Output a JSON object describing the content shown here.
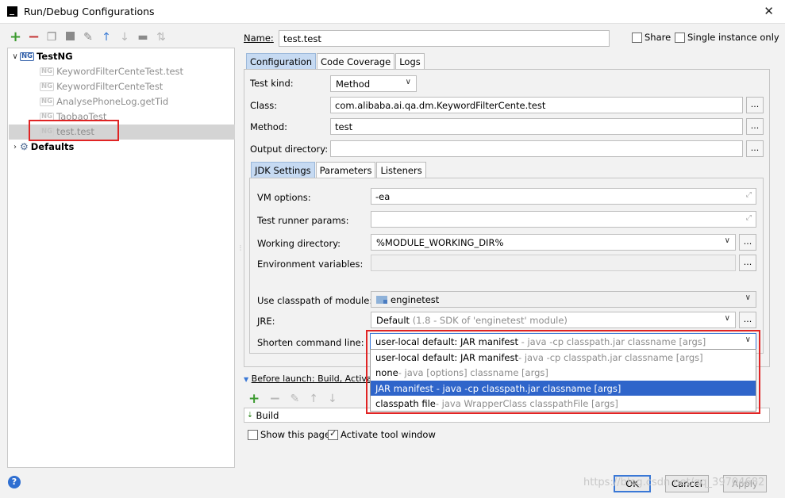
{
  "window": {
    "title": "Run/Debug Configurations",
    "close_glyph": "✕"
  },
  "toolbar": {
    "icons": [
      "add-icon",
      "remove-icon",
      "copy-icon",
      "save-icon",
      "wrench-icon",
      "move-up-icon",
      "move-down-icon",
      "folder-icon",
      "sort-icon"
    ]
  },
  "tree": {
    "root": {
      "label": "TestNG",
      "icon": "NG"
    },
    "children": [
      {
        "label": "KeywordFilterCenteTest.test"
      },
      {
        "label": "KeywordFilterCenteTest"
      },
      {
        "label": "AnalysePhoneLog.getTid"
      },
      {
        "label": "TaobaoTest"
      },
      {
        "label": "test.test",
        "selected": true
      }
    ],
    "defaults": {
      "label": "Defaults"
    }
  },
  "form": {
    "name_label": "Name:",
    "name_value": "test.test",
    "share_label": "Share",
    "single_instance_label": "Single instance only",
    "tabs": [
      "Configuration",
      "Code Coverage",
      "Logs"
    ],
    "test_kind_label": "Test kind:",
    "test_kind_value": "Method",
    "class_label": "Class:",
    "class_value": "com.alibaba.ai.qa.dm.KeywordFilterCente.test",
    "method_label": "Method:",
    "method_value": "test",
    "output_dir_label": "Output directory:",
    "output_dir_value": "",
    "dots": "..."
  },
  "inner": {
    "tabs": [
      "JDK Settings",
      "Parameters",
      "Listeners"
    ],
    "vm_options_label": "VM options:",
    "vm_options_value": "-ea",
    "runner_params_label": "Test runner params:",
    "runner_params_value": "",
    "working_dir_label": "Working directory:",
    "working_dir_value": "%MODULE_WORKING_DIR%",
    "env_vars_label": "Environment variables:",
    "env_vars_value": "",
    "classpath_label": "Use classpath of module:",
    "classpath_value": "enginetest",
    "jre_label": "JRE:",
    "jre_value": "Default",
    "jre_hint": "(1.8 - SDK of 'enginetest' module)",
    "shorten_label": "Shorten command line:",
    "shorten_value": "user-local default: JAR manifest",
    "shorten_hint": "- java -cp classpath.jar classname [args]"
  },
  "dropdown": {
    "options": [
      {
        "main": "user-local default: JAR manifest",
        "hint": " - java -cp classpath.jar classname [args]"
      },
      {
        "main": "none",
        "hint": " - java [options] classname [args]"
      },
      {
        "main": "JAR manifest - java -cp classpath.jar classname [args]",
        "hint": ""
      },
      {
        "main": "classpath file",
        "hint": " - java WrapperClass classpathFile [args]"
      }
    ],
    "highlighted_index": 2
  },
  "before_launch": {
    "label": "Before launch: Build, Activate to",
    "build_label": "Build",
    "show_page_label": "Show this page",
    "activate_window_label": "Activate tool window"
  },
  "footer": {
    "ok": "OK",
    "cancel": "Cancel",
    "apply": "Apply",
    "watermark": "https://blog.csdn.net/qq_39704682"
  },
  "colors": {
    "selection_blue": "#2f65ca",
    "highlight_red": "#e02424",
    "tab_active": "#c6daf2"
  }
}
